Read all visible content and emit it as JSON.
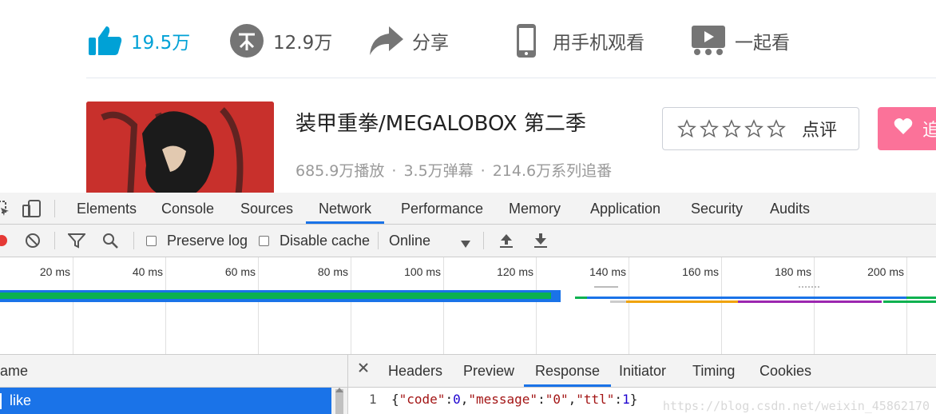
{
  "video": {
    "actions": {
      "like": "19.5万",
      "coin": "12.9万",
      "share": "分享",
      "phone": "用手机观看",
      "watch_together": "一起看"
    },
    "title": "装甲重拳/MEGALOBOX 第二季",
    "stats": {
      "plays": "685.9万播放",
      "danmaku": "3.5万弹幕",
      "follows": "214.6万系列追番",
      "separator": "·"
    },
    "rate_label": "点评",
    "follow_label": "追"
  },
  "devtools": {
    "tabs": [
      "Elements",
      "Console",
      "Sources",
      "Network",
      "Performance",
      "Memory",
      "Application",
      "Security",
      "Audits"
    ],
    "active_tab": "Network",
    "toolbar": {
      "preserve_log": "Preserve log",
      "disable_cache": "Disable cache",
      "throttle": "Online"
    },
    "timeline_ticks": [
      "20 ms",
      "40 ms",
      "60 ms",
      "80 ms",
      "100 ms",
      "120 ms",
      "140 ms",
      "160 ms",
      "180 ms",
      "200 ms"
    ],
    "list_header": "ame",
    "request_name": "like",
    "detail_tabs": [
      "Headers",
      "Preview",
      "Response",
      "Initiator",
      "Timing",
      "Cookies"
    ],
    "active_detail_tab": "Response",
    "response": {
      "line_no": "1",
      "body": "{\"code\":0,\"message\":\"0\",\"ttl\":1}"
    },
    "watermark": "https://blog.csdn.net/weixin_45862170",
    "colors": {
      "accent": "#1a73e8",
      "bar_green": "#0bb14f",
      "bar_blue": "#1a73e8",
      "bar_orange": "#f0a30a",
      "bar_purple": "#9c27b0"
    }
  }
}
